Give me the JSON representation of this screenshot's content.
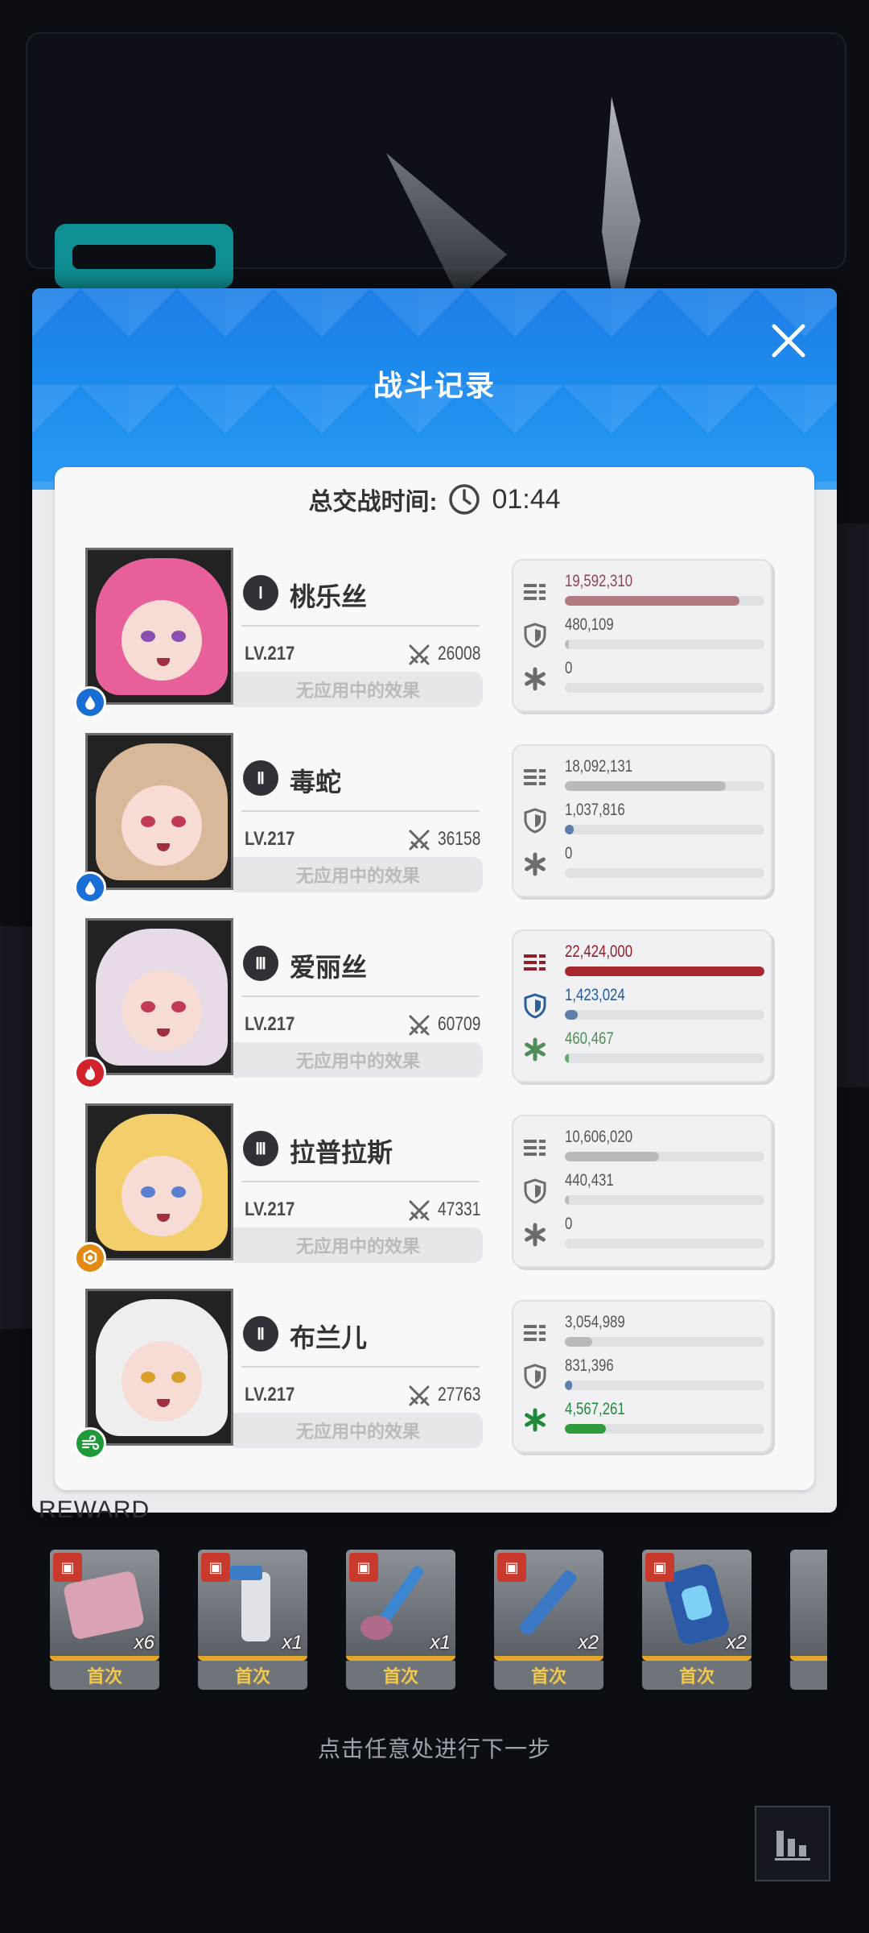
{
  "modal": {
    "title": "战斗记录",
    "total_time_label": "总交战时间:",
    "total_time": "01:44"
  },
  "colors": {
    "header_blue": "#1f8ff0",
    "damage_red": "#a8282f",
    "shield_blue": "#2a6fb0",
    "heal_green": "#2e9c3a",
    "reward_gold": "#e2a62a"
  },
  "rows": [
    {
      "rank": "Ⅰ",
      "name": "桃乐丝",
      "level": "LV.217",
      "power": "26008",
      "effect": "无应用中的效果",
      "element": "water-icon",
      "damage": "19,592,310",
      "damage_ratio": 0.874,
      "shield": "480,109",
      "shield_ratio": 0.02,
      "heal": "0",
      "heal_ratio": 0
    },
    {
      "rank": "Ⅱ",
      "name": "毒蛇",
      "level": "LV.217",
      "power": "36158",
      "effect": "无应用中的效果",
      "element": "water-icon",
      "damage": "18,092,131",
      "damage_ratio": 0.807,
      "shield": "1,037,816",
      "shield_ratio": 0.046,
      "heal": "0",
      "heal_ratio": 0
    },
    {
      "rank": "Ⅲ",
      "name": "爱丽丝",
      "level": "LV.217",
      "power": "60709",
      "effect": "无应用中的效果",
      "element": "fire-icon",
      "damage": "22,424,000",
      "damage_ratio": 1.0,
      "shield": "1,423,024",
      "shield_ratio": 0.063,
      "heal": "460,467",
      "heal_ratio": 0.02
    },
    {
      "rank": "Ⅲ",
      "name": "拉普拉斯",
      "level": "LV.217",
      "power": "47331",
      "effect": "无应用中的效果",
      "element": "iron-icon",
      "damage": "10,606,020",
      "damage_ratio": 0.473,
      "shield": "440,431",
      "shield_ratio": 0.02,
      "heal": "0",
      "heal_ratio": 0
    },
    {
      "rank": "Ⅱ",
      "name": "布兰儿",
      "level": "LV.217",
      "power": "27763",
      "effect": "无应用中的效果",
      "element": "wind-icon",
      "damage": "3,054,989",
      "damage_ratio": 0.136,
      "shield": "831,396",
      "shield_ratio": 0.037,
      "heal": "4,567,261",
      "heal_ratio": 0.204
    }
  ],
  "rewards": {
    "label": "REWARD",
    "items": [
      {
        "icon": "cloth-icon",
        "qty": "x6",
        "tag": "首次"
      },
      {
        "icon": "spray-bottle-icon",
        "qty": "x1",
        "tag": "首次"
      },
      {
        "icon": "brush-icon",
        "qty": "x1",
        "tag": "首次"
      },
      {
        "icon": "syringe-icon",
        "qty": "x2",
        "tag": "首次"
      },
      {
        "icon": "battery-icon",
        "qty": "x2",
        "tag": "首次"
      }
    ]
  },
  "hint": "点击任意处进行下一步"
}
